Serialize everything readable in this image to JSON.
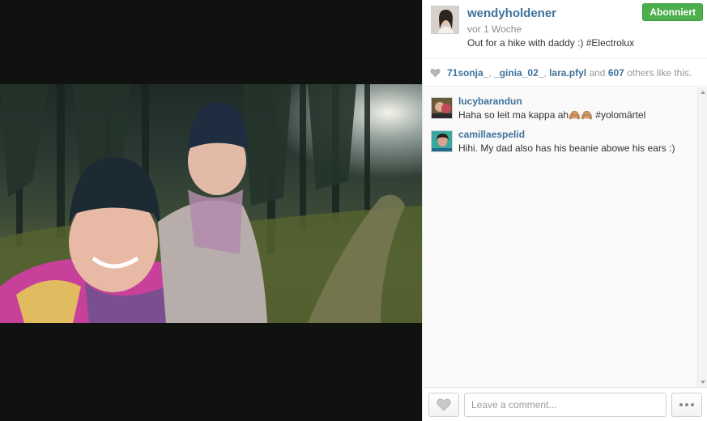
{
  "post": {
    "username": "wendyholdener",
    "time_ago": "vor 1 Woche",
    "caption": "Out for a hike with daddy :) #Electrolux",
    "follow_label": "Abonniert"
  },
  "likes": {
    "users": [
      "71sonja_",
      "_ginia_02_",
      "lara.pfyl"
    ],
    "separator": ", ",
    "and_text": " and ",
    "others_count": "607",
    "suffix": " others like this."
  },
  "comments": [
    {
      "user": "lucybarandun",
      "text": "Haha so leit ma kappa ah🙈🙈 #yolomärtel"
    },
    {
      "user": "camillaespelid",
      "text": "Hihi. My dad also has his beanie abowe his ears :)"
    }
  ],
  "footer": {
    "comment_placeholder": "Leave a comment..."
  },
  "colors": {
    "link": "#3f729b",
    "follow_button": "#4cae4c"
  },
  "icons": [
    "heart-icon",
    "heart-outline-icon",
    "more-options-icon"
  ]
}
